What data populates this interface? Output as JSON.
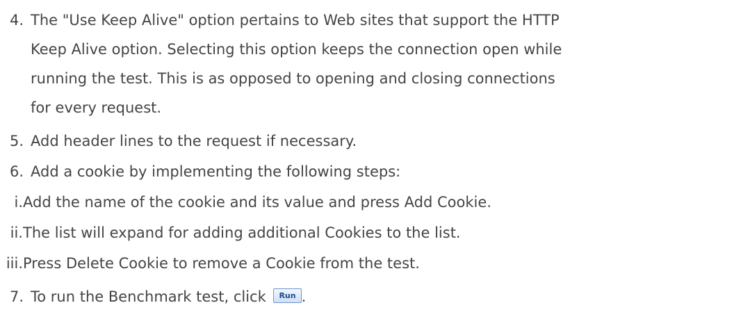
{
  "items": {
    "step4": {
      "number": "4.",
      "lines": [
        "The \"Use Keep Alive\" option pertains to Web sites that support the HTTP",
        "Keep Alive option. Selecting this option keeps the connection open while",
        "running the test. This is as opposed to opening and closing connections",
        "for every request."
      ]
    },
    "step5": {
      "number": "5.",
      "text": "Add header lines to the request if necessary."
    },
    "step6": {
      "number": "6.",
      "text": "Add a cookie by implementing the following steps:"
    },
    "substeps": [
      {
        "number": "i.",
        "text": "Add the name of the cookie and its value and press Add Cookie."
      },
      {
        "number": "ii.",
        "text": "The list will expand for adding additional Cookies to the list."
      },
      {
        "number": "iii.",
        "text": "Press Delete Cookie to remove a Cookie from the test."
      }
    ],
    "step7": {
      "number": "7.",
      "text": "To run the Benchmark test, click",
      "trailing": "."
    }
  },
  "run_button": {
    "label": "Run"
  }
}
